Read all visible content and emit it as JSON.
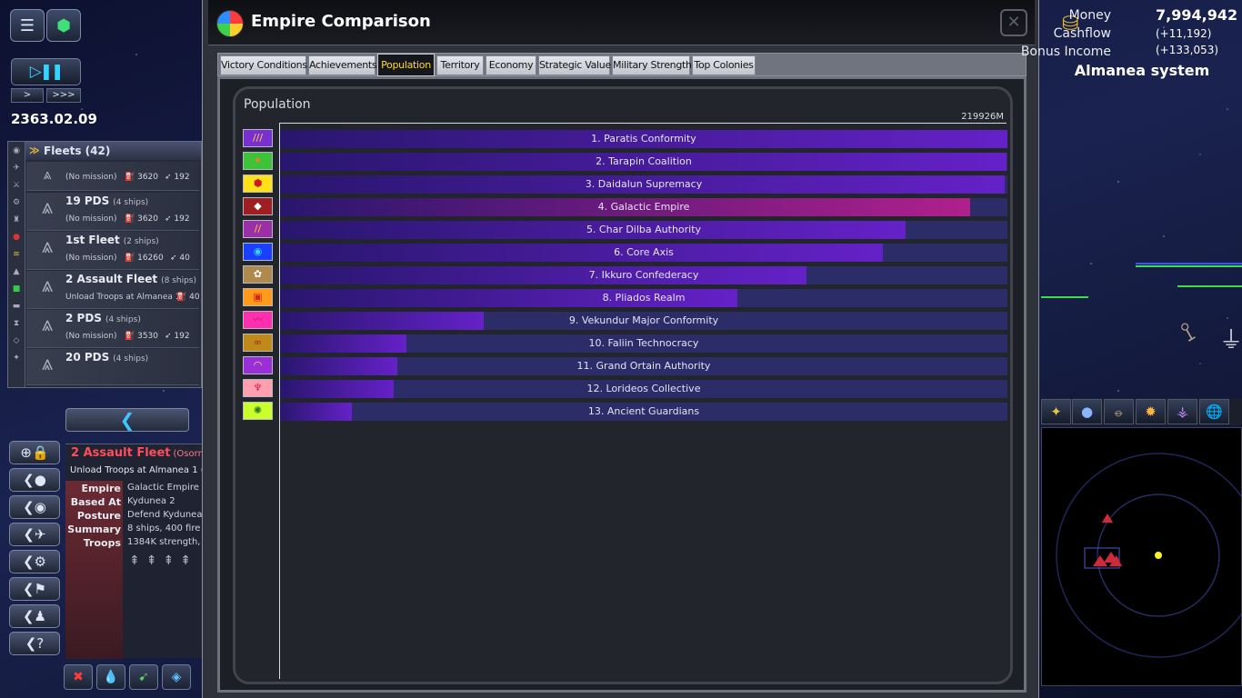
{
  "game": {
    "date": "2363.02.09",
    "speed_buttons": [
      ">",
      ">>>"
    ]
  },
  "fleets": {
    "header": "Fleets (42)",
    "items": [
      {
        "name": "",
        "ships": "",
        "mission": "(No mission)",
        "fuel": "3620",
        "ammo": "192"
      },
      {
        "name": "19 PDS",
        "ships": "(4 ships)",
        "mission": "(No mission)",
        "fuel": "3620",
        "ammo": "192"
      },
      {
        "name": "1st Fleet",
        "ships": "(2 ships)",
        "mission": "(No mission)",
        "fuel": "16260",
        "ammo": "40"
      },
      {
        "name": "2 Assault Fleet",
        "ships": "(8 ships)",
        "mission": "Unload Troops at Almanea 1",
        "fuel": "",
        "ammo": "40"
      },
      {
        "name": "2 PDS",
        "ships": "(4 ships)",
        "mission": "(No mission)",
        "fuel": "3530",
        "ammo": "192"
      },
      {
        "name": "20 PDS",
        "ships": "(4 ships)",
        "mission": "",
        "fuel": "",
        "ammo": ""
      }
    ]
  },
  "selected_fleet": {
    "title": "2 Assault Fleet",
    "title_suffix": "(Osorn",
    "mission": "Unload Troops at Almanea 1 (",
    "rows": [
      {
        "label": "Empire",
        "value": "Galactic Empire"
      },
      {
        "label": "Based At",
        "value": "Kydunea 2"
      },
      {
        "label": "Posture",
        "value": "Defend Kydunea"
      },
      {
        "label": "Summary",
        "value": "8 ships, 400 fire"
      },
      {
        "label": "Troops",
        "value": "1384K strength,"
      }
    ]
  },
  "window": {
    "title": "Empire Comparison",
    "close_icon": "close-icon",
    "tabs": [
      {
        "label": "Victory Conditions",
        "active": false
      },
      {
        "label": "Achievements",
        "active": false
      },
      {
        "label": "Population",
        "active": true
      },
      {
        "label": "Territory",
        "active": false
      },
      {
        "label": "Economy",
        "active": false
      },
      {
        "label": "Strategic Value",
        "active": false
      },
      {
        "label": "Military Strength",
        "active": false
      },
      {
        "label": "Top Colonies",
        "active": false
      }
    ]
  },
  "chart_data": {
    "type": "bar",
    "title": "Population",
    "max_label": "219926M",
    "categories": [
      "1. Paratis Conformity",
      "2. Tarapin Coalition",
      "3. Daidalun Supremacy",
      "4. Galactic Empire",
      "5. Char Dilba Authority",
      "6. Core Axis",
      "7. Ikkuro Confederacy",
      "8. Pliados Realm",
      "9. Vekundur Major Conformity",
      "10. Faliin Technocracy",
      "11. Grand Ortain Authority",
      "12. Lorideos Collective",
      "13. Ancient Guardians"
    ],
    "values": [
      219926,
      219700,
      219100,
      208600,
      189000,
      182400,
      159200,
      138200,
      61500,
      38200,
      35500,
      34300,
      21800
    ],
    "xlim": [
      0,
      219926
    ],
    "highlight": "4. Galactic Empire",
    "colors": {
      "bar": "#6521c8",
      "highlight": "#b0208c",
      "track": "#2b2c68"
    },
    "icons": [
      {
        "bg": "#7a2fd0",
        "glyph": "///",
        "color": "#ffd23c"
      },
      {
        "bg": "#3ec23a",
        "glyph": "✦",
        "color": "#ff7b1c"
      },
      {
        "bg": "#ffe019",
        "glyph": "⬢",
        "color": "#cc1a1a"
      },
      {
        "bg": "#9e1f22",
        "glyph": "◆",
        "color": "#ffffff"
      },
      {
        "bg": "#9a2fa8",
        "glyph": "//",
        "color": "#ffc43a"
      },
      {
        "bg": "#1a3fff",
        "glyph": "◉",
        "color": "#33d6ff"
      },
      {
        "bg": "#b08a4c",
        "glyph": "✿",
        "color": "#ffffff"
      },
      {
        "bg": "#ff9a1a",
        "glyph": "▣",
        "color": "#e02020"
      },
      {
        "bg": "#ff2fb0",
        "glyph": "〰",
        "color": "#c01060"
      },
      {
        "bg": "#c08a1a",
        "glyph": "∞",
        "color": "#a02020"
      },
      {
        "bg": "#9a2fd8",
        "glyph": "◠",
        "color": "#ffe07a"
      },
      {
        "bg": "#ff9fb0",
        "glyph": "♆",
        "color": "#e01c40"
      },
      {
        "bg": "#c9ff2a",
        "glyph": "✺",
        "color": "#2a7a2a"
      }
    ]
  },
  "resources": {
    "money_label": "Money",
    "money_value": "7,994,942",
    "cashflow_label": "Cashflow",
    "cashflow_value": "(+11,192)",
    "bonus_label": "Bonus Income",
    "bonus_value": "(+133,053)"
  },
  "system": {
    "name": "Almanea system"
  }
}
